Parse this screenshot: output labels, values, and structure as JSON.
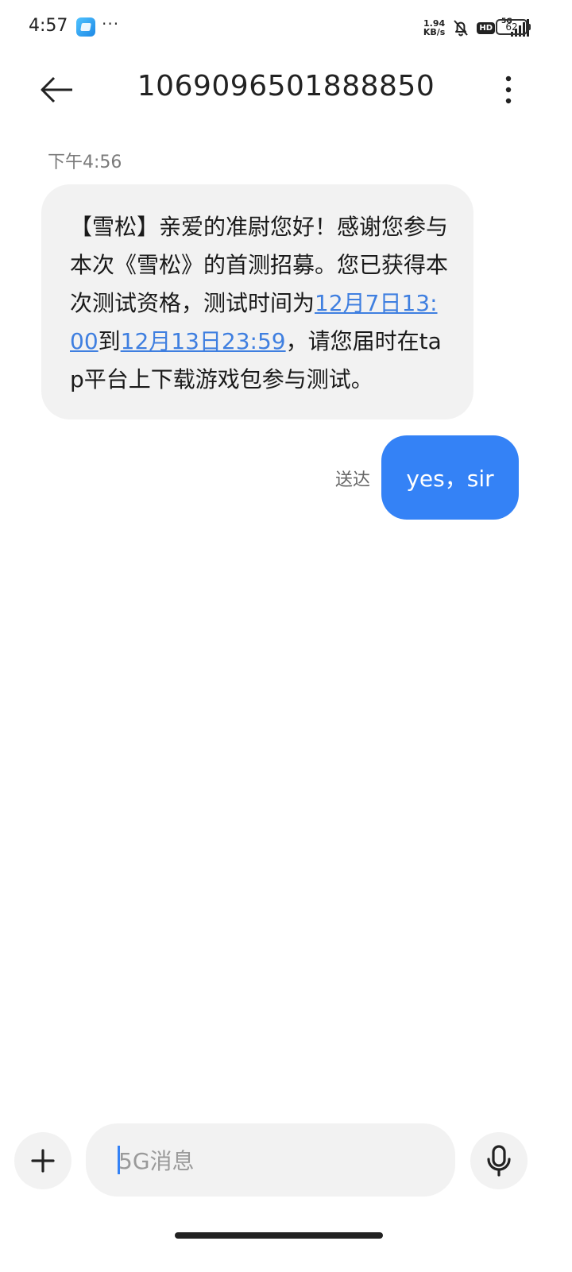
{
  "status_bar": {
    "time": "4:57",
    "more": "···",
    "net_speed_value": "1.94",
    "net_speed_unit": "KB/s",
    "hd": "HD",
    "network": "5G",
    "battery": "62"
  },
  "header": {
    "title": "1069096501888850",
    "back_icon": "arrow-left-icon",
    "more_icon": "more-vertical-icon"
  },
  "conversation": {
    "timestamp": "下午4:56",
    "incoming": {
      "text_before": "【雪松】亲爱的准尉您好！感谢您参与本次《雪松》的首测招募。您已获得本次测试资格，测试时间为",
      "link1": "12月7日13:00",
      "middle": "到",
      "link2": "12月13日23:59",
      "text_after": "，请您届时在tap平台上下载游戏包参与测试。"
    },
    "outgoing": {
      "status": "送达",
      "text": "yes，sir"
    }
  },
  "composer": {
    "placeholder": "5G消息",
    "add_icon": "plus-icon",
    "mic_icon": "microphone-icon"
  },
  "colors": {
    "accent": "#3482f6",
    "link": "#3f7fe0",
    "bubble_in": "#f2f2f2"
  }
}
